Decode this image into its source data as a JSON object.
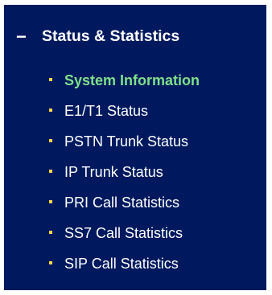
{
  "menu": {
    "section_title": "Status & Statistics",
    "collapse_symbol": "−",
    "items": [
      {
        "label": "System Information",
        "active": true
      },
      {
        "label": "E1/T1 Status",
        "active": false
      },
      {
        "label": "PSTN Trunk Status",
        "active": false
      },
      {
        "label": "IP Trunk Status",
        "active": false
      },
      {
        "label": "PRI Call Statistics",
        "active": false
      },
      {
        "label": "SS7 Call Statistics",
        "active": false
      },
      {
        "label": "SIP Call Statistics",
        "active": false
      }
    ]
  },
  "colors": {
    "panel_background": "#00195e",
    "text": "#ffffff",
    "active_text": "#7ee08a",
    "bullet": "#ffd64a"
  }
}
